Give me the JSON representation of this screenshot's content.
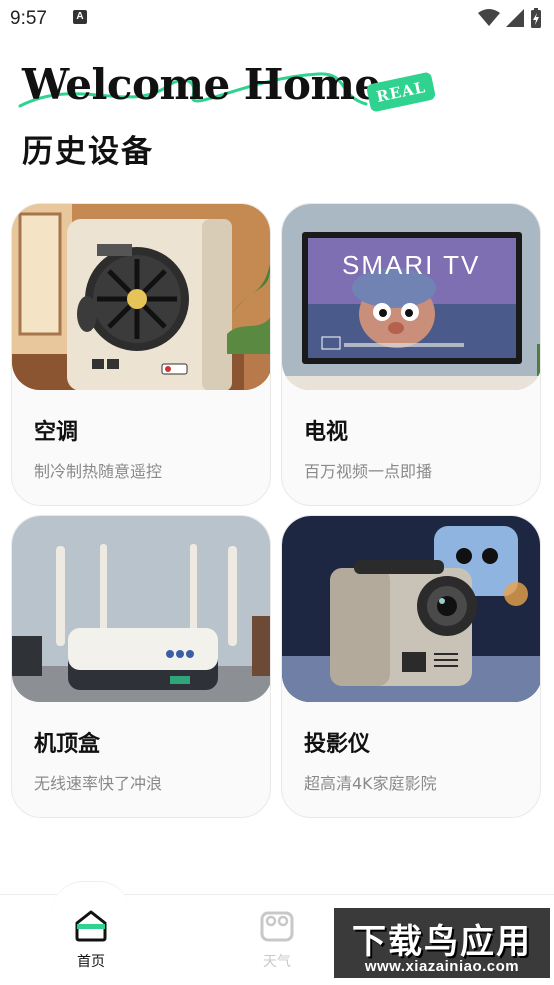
{
  "status_bar": {
    "time": "9:57",
    "notification_letter": "A"
  },
  "header": {
    "welcome": "Welcome Home",
    "badge": "REAL",
    "section_title": "历史设备"
  },
  "devices": [
    {
      "title": "空调",
      "subtitle": "制冷制热随意遥控",
      "image": "air-conditioner"
    },
    {
      "title": "电视",
      "subtitle": "百万视频一点即播",
      "image": "smart-tv",
      "screen_text": "SMARI TV"
    },
    {
      "title": "机顶盒",
      "subtitle": "无线速率快了冲浪",
      "image": "set-top-box"
    },
    {
      "title": "投影仪",
      "subtitle": "超高清4K家庭影院",
      "image": "projector"
    }
  ],
  "nav": [
    {
      "label": "首页",
      "icon": "home-icon",
      "active": true
    },
    {
      "label": "天气",
      "icon": "weather-icon",
      "active": false
    }
  ],
  "watermark": {
    "big": "下载鸟应用",
    "small": "www.xiazainiao.com"
  },
  "colors": {
    "accent": "#2fd38f",
    "text": "#111111",
    "subtext": "#8a8a8a",
    "inactive": "#c8c8c8"
  }
}
